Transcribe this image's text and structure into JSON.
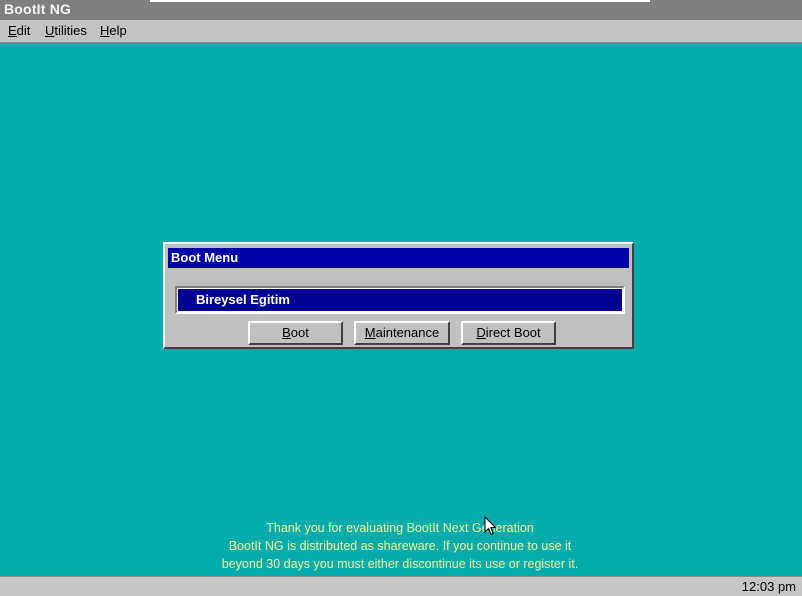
{
  "window": {
    "title": "BootIt NG"
  },
  "menu": {
    "edit": {
      "first": "E",
      "rest": "dit"
    },
    "utilities": {
      "first": "U",
      "rest": "tilities"
    },
    "help": {
      "first": "H",
      "rest": "elp"
    }
  },
  "boot_menu": {
    "title": "Boot Menu",
    "entries": [
      "Bireysel Egitim"
    ],
    "buttons": {
      "boot": {
        "first": "B",
        "rest": "oot"
      },
      "maintenance": {
        "first": "M",
        "rest": "aintenance"
      },
      "direct_boot": {
        "first": "D",
        "rest": "irect Boot"
      }
    }
  },
  "notice": {
    "line1": "Thank you for evaluating BootIt Next Generation",
    "line2": "BootIt NG is distributed as shareware.  If you continue to use it",
    "line3": "beyond 30 days you must either discontinue its use or register it."
  },
  "status": {
    "clock": "12:03 pm"
  },
  "colors": {
    "desktop": "#06abab",
    "dialog_title": "#0000a6",
    "selected_entry": "#000090",
    "notice_text": "#f2f09a"
  }
}
